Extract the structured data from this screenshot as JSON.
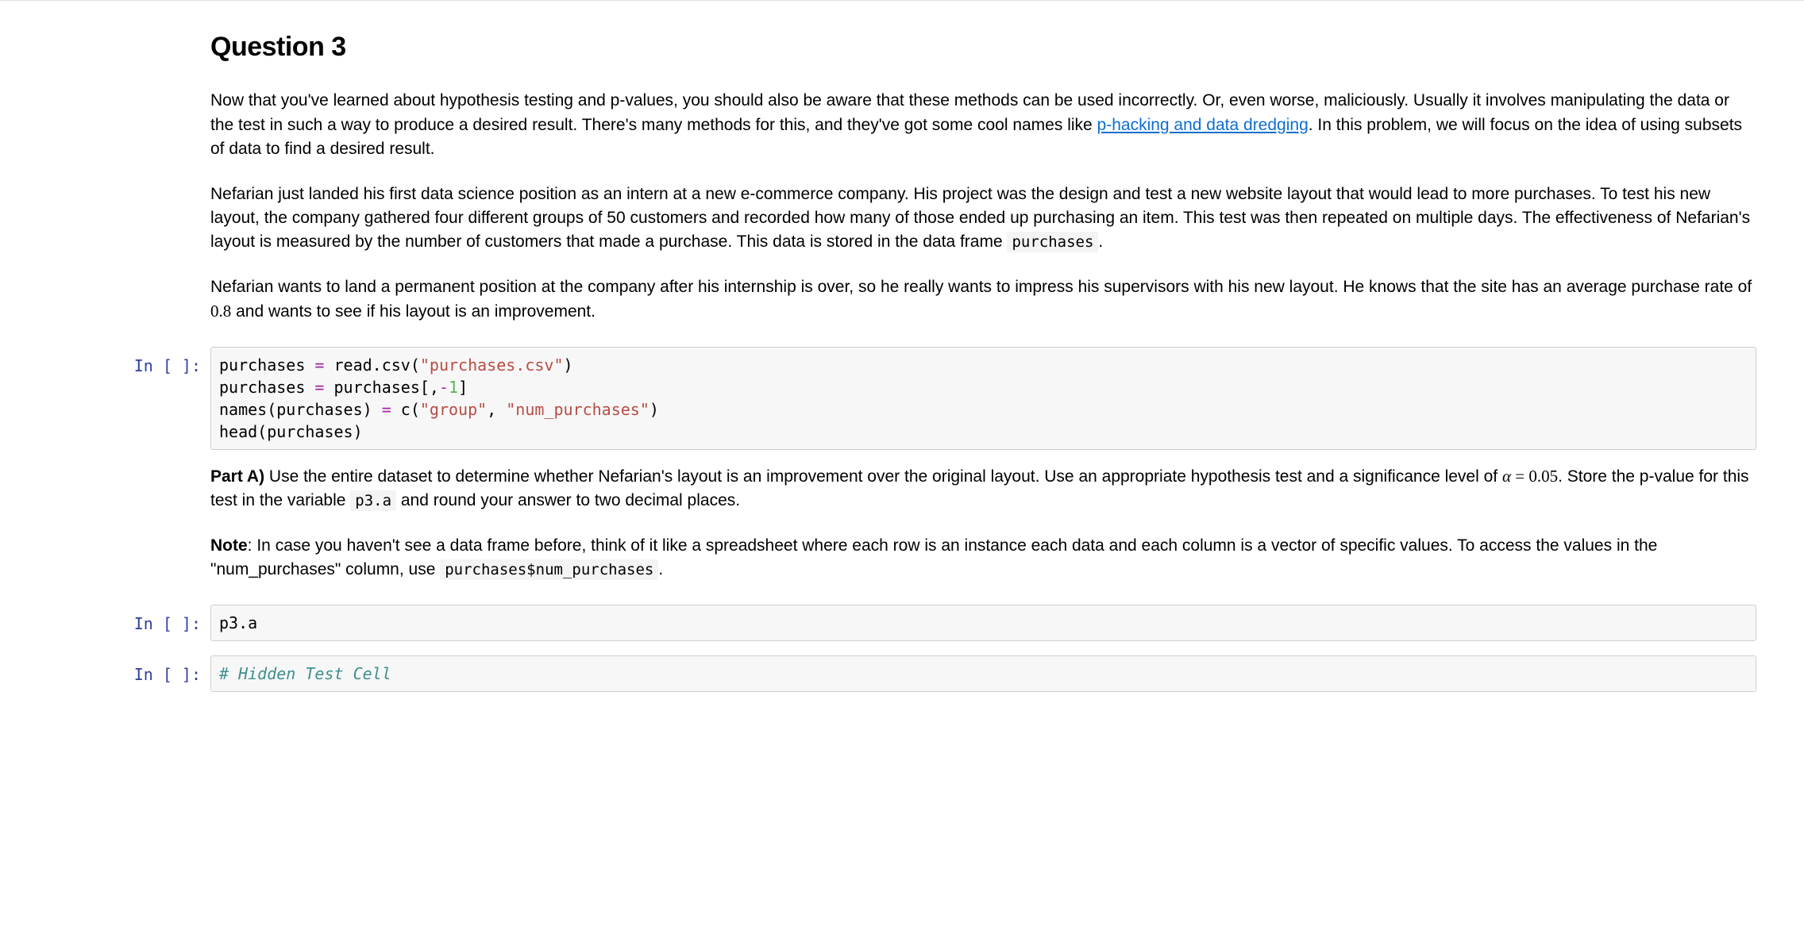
{
  "heading": "Question 3",
  "para1": {
    "t1": "Now that you've learned about hypothesis testing and p-values, you should also be aware that these methods can be used incorrectly. Or, even worse, maliciously. Usually it involves manipulating the data or the test in such a way to produce a desired result. There's many methods for this, and they've got some cool names like ",
    "link": "p-hacking and data dredging",
    "t2": ". In this problem, we will focus on the idea of using subsets of data to find a desired result."
  },
  "para2": {
    "t1": "Nefarian just landed his first data science position as an intern at a new e-commerce company. His project was the design and test a new website layout that would lead to more purchases. To test his new layout, the company gathered four different groups of 50 customers and recorded how many of those ended up purchasing an item. This test was then repeated on multiple days. The effectiveness of Nefarian's layout is measured by the number of customers that made a purchase. This data is stored in the data frame ",
    "code": "purchases",
    "t2": "."
  },
  "para3": {
    "t1": "Nefarian wants to land a permanent position at the company after his internship is over, so he really wants to impress his supervisors with his new layout. He knows that the site has an average purchase rate of ",
    "num": "0.8",
    "t2": " and wants to see if his layout is an improvement."
  },
  "partA": {
    "label": "Part A)",
    "t1": " Use the entire dataset to determine whether Nefarian's layout is an improvement over the original layout. Use an appropriate hypothesis test and a significance level of ",
    "alpha": "α",
    "eq": " = ",
    "alphaVal": "0.05",
    "t2": ". Store the p-value for this test in the variable ",
    "code": "p3.a",
    "t3": " and round your answer to two decimal places."
  },
  "note": {
    "label": "Note",
    "t1": ": In case you haven't see a data frame before, think of it like a spreadsheet where each row is an instance each data and each column is a vector of specific values. To access the values in the \"num_purchases\" column, use ",
    "code": "purchases$num_purchases",
    "t2": "."
  },
  "prompts": {
    "in_empty": "In [ ]:"
  },
  "code1": {
    "l1a": "purchases ",
    "l1op": "=",
    "l1b": " read.csv(",
    "l1str": "\"purchases.csv\"",
    "l1c": ")",
    "l2a": "purchases ",
    "l2op": "=",
    "l2b": " purchases[,",
    "l2op2": "-",
    "l2num": "1",
    "l2c": "]",
    "l3a": "names(purchases) ",
    "l3op": "=",
    "l3b": " c(",
    "l3str1": "\"group\"",
    "l3c": ", ",
    "l3str2": "\"num_purchases\"",
    "l3d": ")",
    "l4": "head(purchases)"
  },
  "code2": {
    "l1": "p3.a"
  },
  "code3": {
    "l1": "# Hidden Test Cell"
  }
}
